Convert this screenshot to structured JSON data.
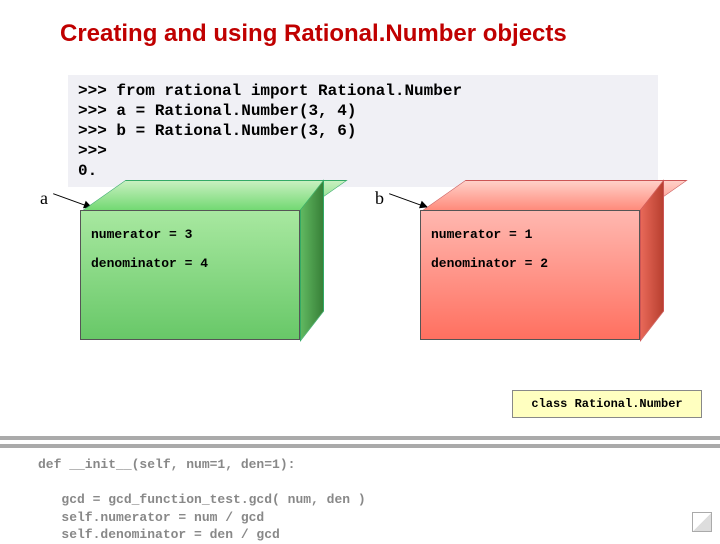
{
  "title": "Creating and using Rational.Number objects",
  "code_block": ">>> from rational import Rational.Number\n>>> a = Rational.Number(3, 4)\n>>> b = Rational.Number(3, 6)\n>>>\n0. ",
  "labels": {
    "a": "a",
    "b": "b"
  },
  "object_a": {
    "numerator_line": "numerator = 3",
    "denominator_line": "denominator = 4"
  },
  "object_b": {
    "numerator_line": "numerator = 1",
    "denominator_line": "denominator = 2"
  },
  "class_label": "class Rational.Number",
  "faded_code": "def __init__(self, num=1, den=1):\n\n   gcd = gcd_function_test.gcd( num, den )\n   self.numerator = num / gcd\n   self.denominator = den / gcd"
}
